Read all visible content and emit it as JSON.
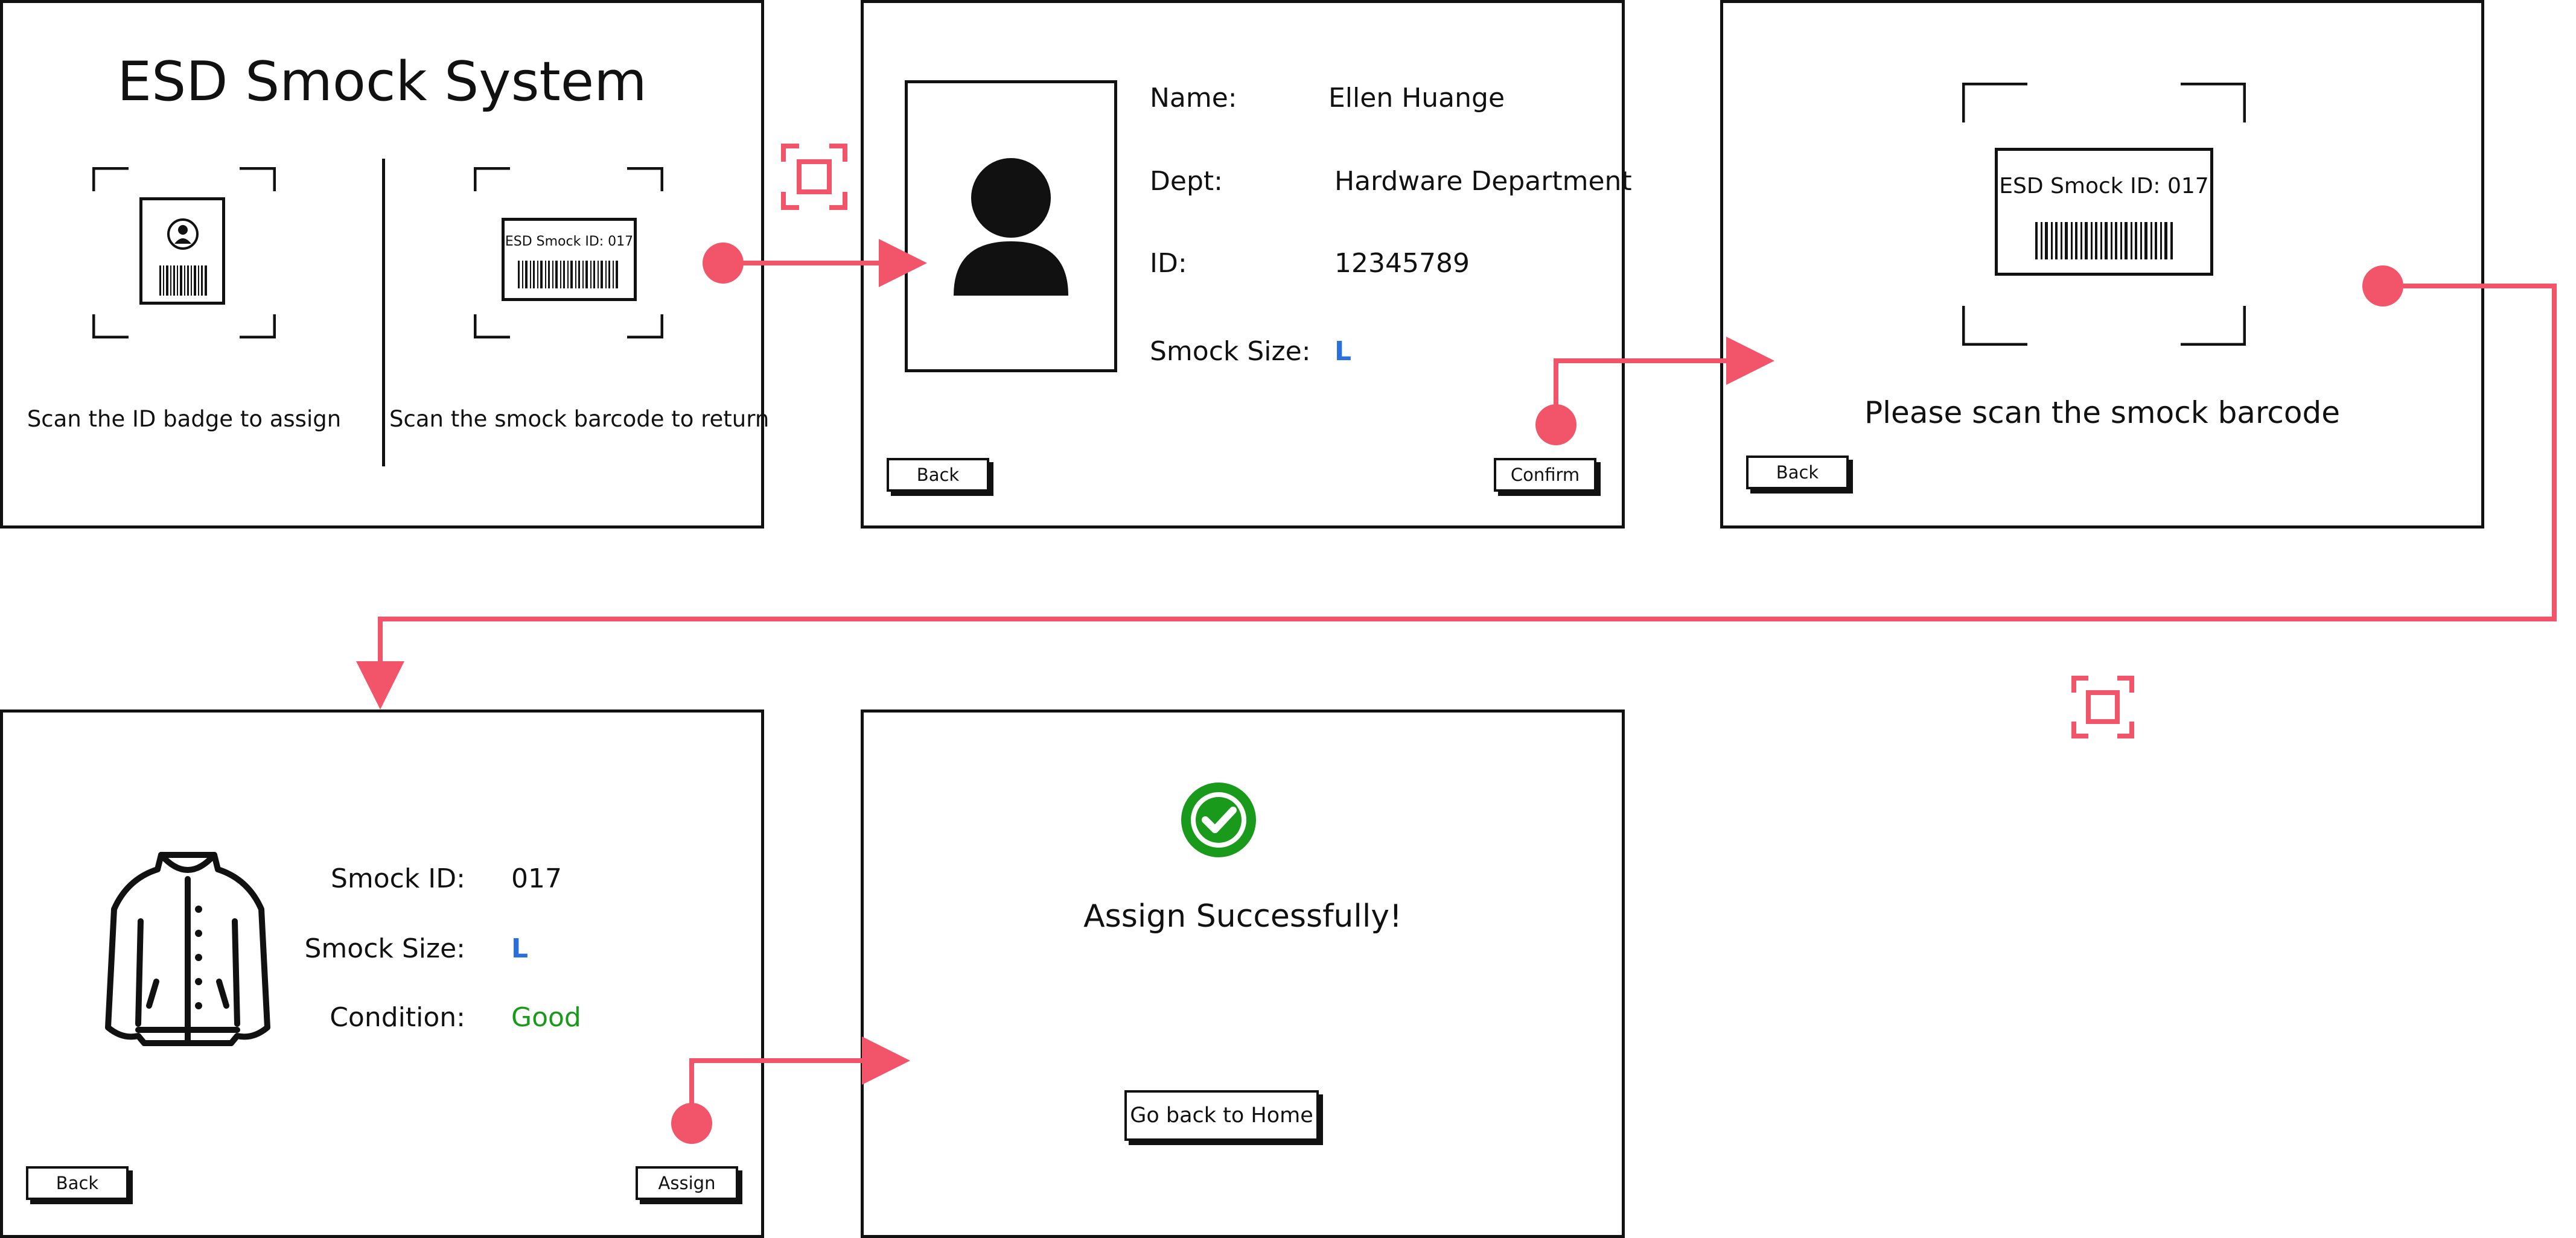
{
  "screen_home": {
    "title": "ESD Smock System",
    "assign_caption": "Scan the ID badge to assign",
    "return_caption": "Scan the smock barcode to return",
    "smock_tag_text": "ESD Smock ID: 017"
  },
  "screen_profile": {
    "name_label": "Name:",
    "name_value": "Ellen Huange",
    "dept_label": "Dept:",
    "dept_value": "Hardware Department",
    "id_label": "ID:",
    "id_value": "12345789",
    "size_label": "Smock Size:",
    "size_value": "L",
    "back_label": "Back",
    "confirm_label": "Confirm"
  },
  "screen_scan": {
    "tag_text": "ESD Smock ID: 017",
    "prompt": "Please scan the smock barcode",
    "back_label": "Back"
  },
  "screen_smock": {
    "id_label": "Smock ID:",
    "id_value": "017",
    "size_label": "Smock Size:",
    "size_value": "L",
    "condition_label": "Condition:",
    "condition_value": "Good",
    "back_label": "Back",
    "assign_label": "Assign"
  },
  "screen_success": {
    "message": "Assign Successfully!",
    "home_label": "Go back to Home"
  },
  "colors": {
    "flow": "#f2546a",
    "accent_blue": "#2a6fe0",
    "success_green": "#1a9a1a"
  },
  "icons": [
    "user-icon",
    "barcode-icon",
    "scan-icon",
    "jacket-icon",
    "check-circle-icon"
  ]
}
